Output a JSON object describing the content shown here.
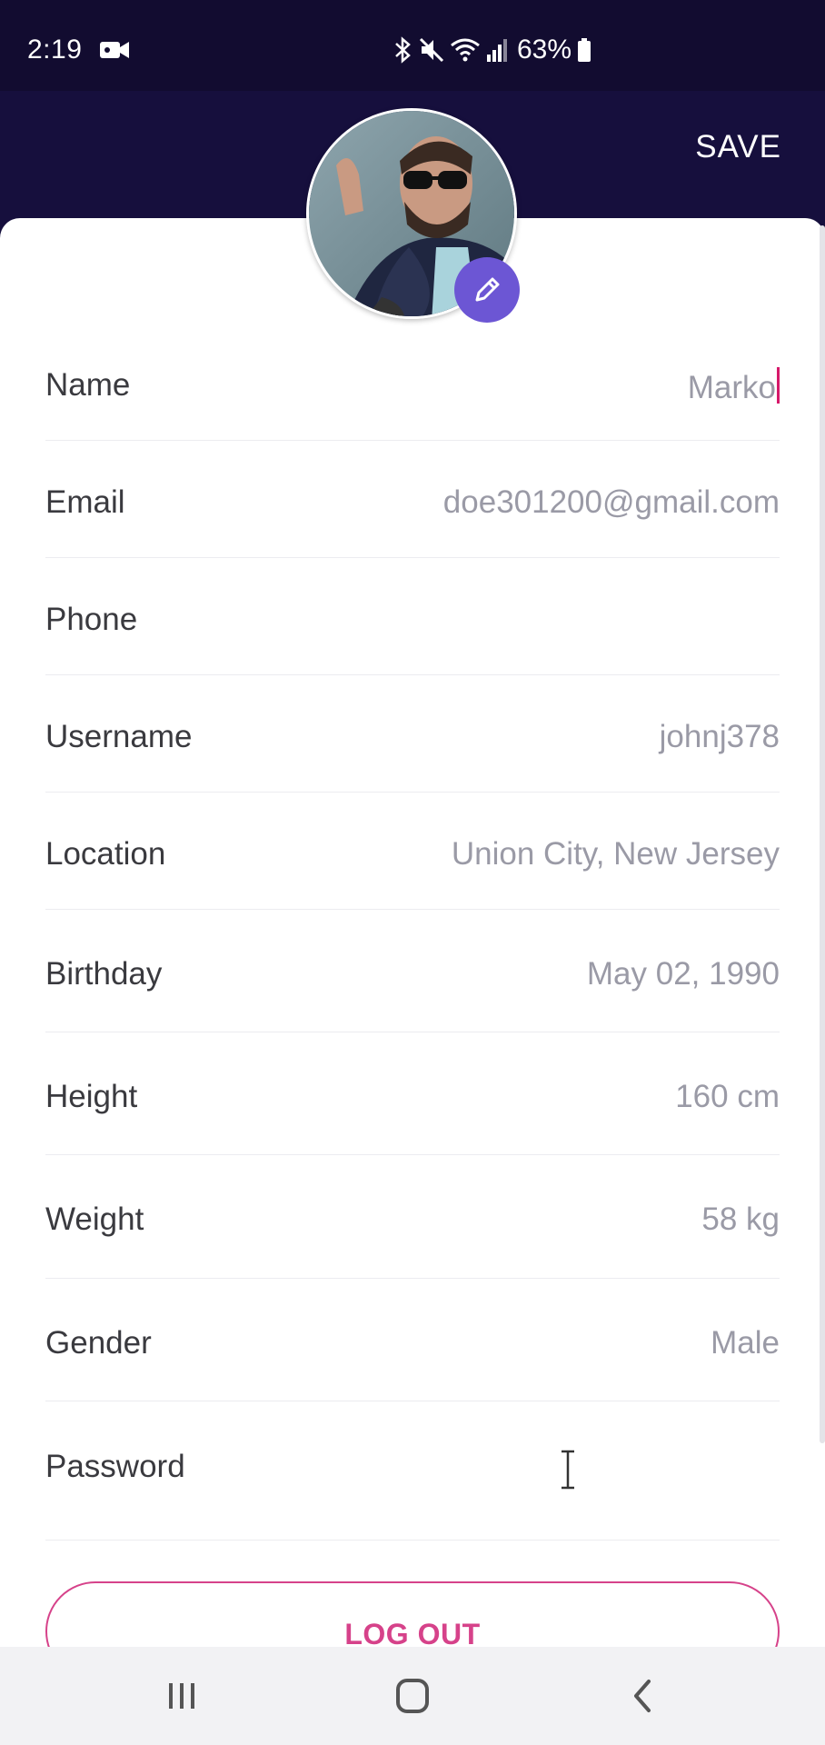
{
  "status_bar": {
    "time": "2:19",
    "battery": "63%",
    "icons": [
      "video-camera-icon",
      "bluetooth-icon",
      "mute-icon",
      "wifi-icon",
      "signal-icon",
      "battery-icon"
    ]
  },
  "header": {
    "save_label": "SAVE",
    "background_color": "#160f3d"
  },
  "profile": {
    "avatar": "profile-photo",
    "edit_icon": "pencil-icon",
    "accent_color": "#6c56d4"
  },
  "fields": [
    {
      "label": "Name",
      "value": "Marko"
    },
    {
      "label": "Email",
      "value": "doe301200@gmail.com"
    },
    {
      "label": "Phone",
      "value": ""
    },
    {
      "label": "Username",
      "value": "johnj378"
    },
    {
      "label": "Location",
      "value": "Union City, New Jersey"
    },
    {
      "label": "Birthday",
      "value": "May 02, 1990"
    },
    {
      "label": "Height",
      "value": "160 cm"
    },
    {
      "label": "Weight",
      "value": "58 kg"
    },
    {
      "label": "Gender",
      "value": "Male"
    },
    {
      "label": "Password",
      "value": ""
    }
  ],
  "logout": {
    "label": "LOG OUT",
    "color": "#d6428a"
  },
  "nav_bar": {
    "buttons": [
      "recent-apps-icon",
      "home-icon",
      "back-icon"
    ]
  }
}
